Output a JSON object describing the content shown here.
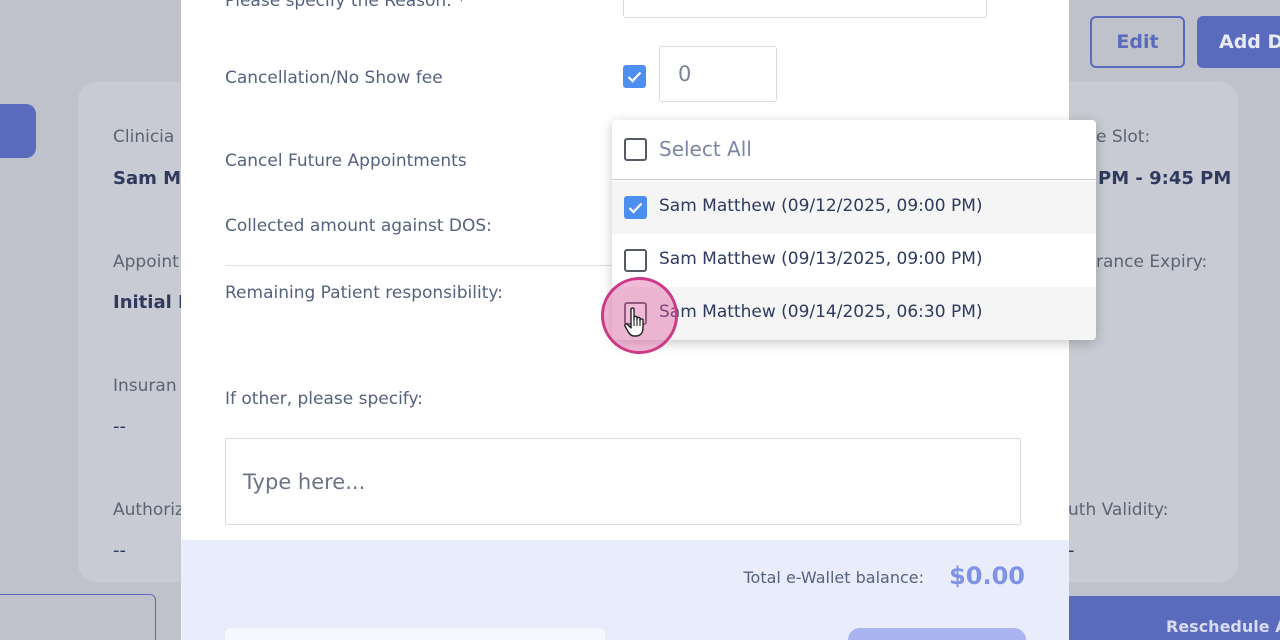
{
  "background": {
    "edit_button": "Edit",
    "add_button": "Add D",
    "left_col": {
      "clinician_label": "Clinicia",
      "clinician_value": "Sam M",
      "appointment_label": "Appoint",
      "appointment_value": "Initial E",
      "insurance_label": "Insuran",
      "insurance_value": "--",
      "authorization_label": "Authoriz",
      "authorization_value": "--"
    },
    "right_col": {
      "slot_label": "e Slot:",
      "slot_value": "PM - 9:45 PM",
      "expiry_label": "rance Expiry:",
      "auth_validity_label": "uth Validity:",
      "auth_validity_value": "-"
    },
    "reschedule_button": "Reschedule A"
  },
  "modal": {
    "reason_label": "Please specify the Reason:",
    "reason_required_mark": "*",
    "fee_label": "Cancellation/No Show fee",
    "fee_checked": true,
    "fee_value": "0",
    "cancel_future_label": "Cancel Future Appointments",
    "collected_label": "Collected amount against DOS:",
    "remaining_label": "Remaining Patient responsibility:",
    "other_label": "If other, please specify:",
    "other_placeholder": "Type here...",
    "wallet_label": "Total e-Wallet balance:",
    "wallet_value": "$0.00",
    "colors": {
      "accent": "#4d8ff0",
      "brand": "#5a6bbd",
      "wallet": "#7f92e6"
    }
  },
  "dropdown": {
    "select_all_label": "Select All",
    "select_all_checked": false,
    "items": [
      {
        "label": "Sam Matthew (09/12/2025, 09:00 PM)",
        "checked": true
      },
      {
        "label": "Sam Matthew (09/13/2025, 09:00 PM)",
        "checked": false
      },
      {
        "label": "Sam Matthew (09/14/2025, 06:30 PM)",
        "checked": false
      }
    ]
  },
  "cursor": {
    "icon": "hand-pointer-icon"
  }
}
